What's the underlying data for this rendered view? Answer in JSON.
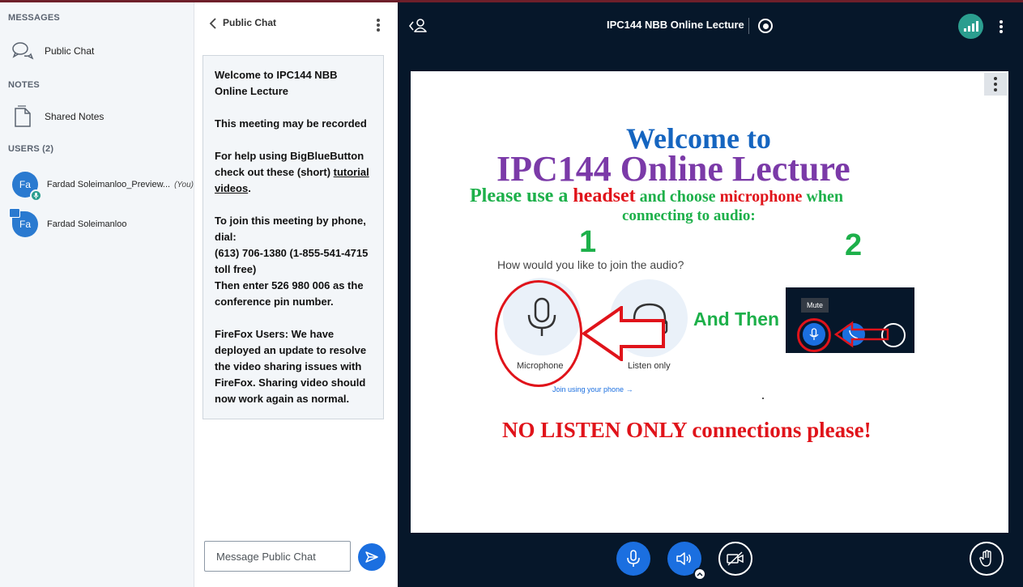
{
  "user_panel": {
    "messages_title": "MESSAGES",
    "public_chat_item": "Public Chat",
    "notes_title": "NOTES",
    "shared_notes_item": "Shared Notes",
    "users_title": "USERS (2)",
    "users": [
      {
        "initials": "Fa",
        "name": "Fardad Soleimanloo_Preview...",
        "suffix": "(You)"
      },
      {
        "initials": "Fa",
        "name": "Fardad Soleimanloo",
        "suffix": ""
      }
    ]
  },
  "chat": {
    "header_title": "Public Chat",
    "welcome": {
      "p1": "Welcome to IPC144 NBB Online Lecture",
      "p2": "This meeting may be recorded",
      "p3_before": "For help using BigBlueButton check out these (short) ",
      "p3_link": "tutorial videos",
      "p3_after": ".",
      "p4_intro": "To join this meeting by phone, dial:",
      "p4_number": "(613) 706-1380 (1-855-541-4715 toll free)",
      "p4_pin": "Then enter 526 980 006 as the conference pin number.",
      "p5": "FireFox Users: We have deployed an update to resolve the video sharing issues with FireFox. Sharing video should now work again as normal."
    },
    "input_placeholder": "Message Public Chat"
  },
  "header": {
    "meeting_title": "IPC144 NBB Online Lecture"
  },
  "slide": {
    "welcome_line": "Welcome to",
    "course_line": "IPC144 Online Lecture",
    "instr_please": "Please use a ",
    "instr_headset": "headset",
    "instr_choose": " and choose ",
    "instr_microphone": "microphone",
    "instr_when": " when",
    "instr_line2": "connecting to audio:",
    "step1": "1",
    "step2": "2",
    "question": "How would you like to join the audio?",
    "microphone_label": "Microphone",
    "listen_only_label": "Listen only",
    "join_phone_link": "Join using your phone →",
    "and_then": "And Then",
    "mute_tooltip": "Mute",
    "no_listen": "NO LISTEN ONLY connections please!"
  },
  "colors": {
    "dark_bg": "#06172a",
    "primary_blue": "#1b6fe0",
    "slide_blue": "#1565c0",
    "slide_purple": "#7b3aa8",
    "slide_green": "#1db04a",
    "slide_red": "#e0131a"
  }
}
